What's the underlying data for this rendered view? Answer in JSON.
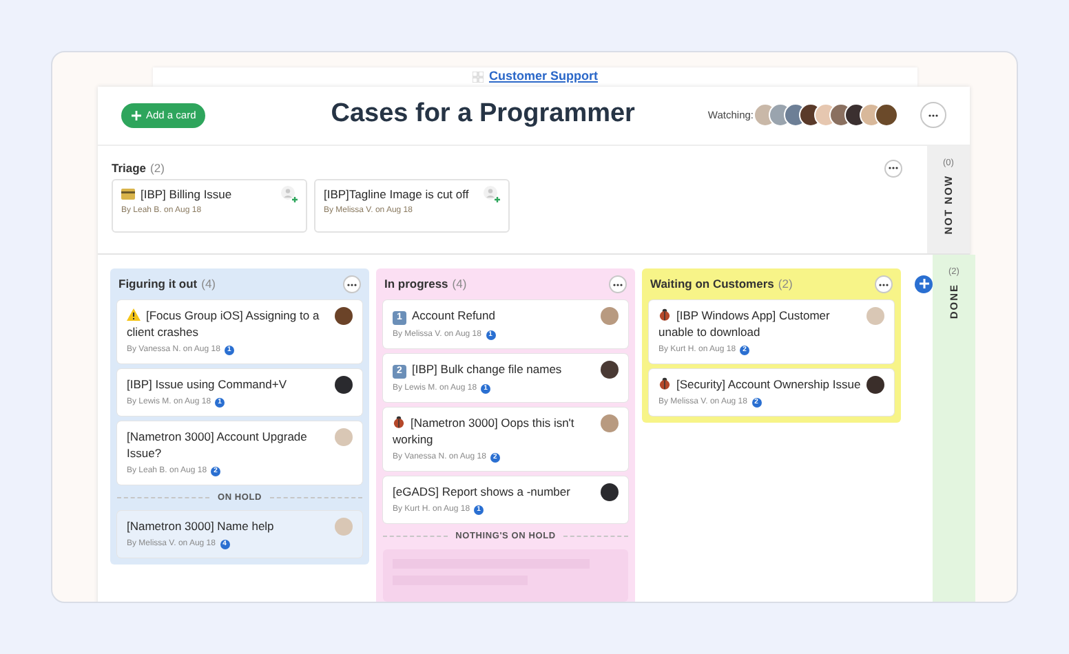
{
  "breadcrumb": {
    "label": "Customer Support"
  },
  "header": {
    "add_button": "Add a card",
    "title": "Cases for a Programmer",
    "watching_label": "Watching:",
    "watchers": [
      {
        "color": "#c9b8a8"
      },
      {
        "color": "#9aa4ae"
      },
      {
        "color": "#6d7f96"
      },
      {
        "color": "#5a3a2a"
      },
      {
        "color": "#e6c7b0"
      },
      {
        "color": "#8a7060"
      },
      {
        "color": "#3b3030"
      },
      {
        "color": "#d8b89a"
      },
      {
        "color": "#6b4a2a"
      }
    ]
  },
  "triage": {
    "title": "Triage",
    "count": "(2)",
    "cards": [
      {
        "icon": {
          "kind": "card"
        },
        "title": "[IBP] Billing Issue",
        "meta": "By Leah B. on Aug 18"
      },
      {
        "title": "[IBP]Tagline Image is cut off",
        "meta": "By Melissa V. on Aug 18"
      }
    ]
  },
  "side_columns": [
    {
      "kind": "not_now",
      "count": "(0)",
      "label": "NOT NOW"
    },
    {
      "kind": "done",
      "count": "(2)",
      "label": "DONE"
    }
  ],
  "columns": [
    {
      "kind": "blue",
      "title": "Figuring it out",
      "count": "(4)",
      "cards": [
        {
          "icon": {
            "kind": "warning"
          },
          "title": "[Focus Group iOS] Assigning to a client crashes",
          "meta": "By Vanessa N. on Aug 18",
          "badge": "1",
          "avatar": {
            "color": "#6b4328"
          }
        },
        {
          "title": "[IBP] Issue using Command+V",
          "meta": "By Lewis M. on Aug 18",
          "badge": "1",
          "avatar": {
            "color": "#2a2a2e"
          }
        },
        {
          "title": "[Nametron 3000] Account Upgrade Issue?",
          "meta": "By Leah B. on Aug 18",
          "badge": "2",
          "avatar": {
            "color": "#d9c7b5"
          }
        }
      ],
      "hold_label": "ON HOLD",
      "hold_cards": [
        {
          "title": "[Nametron 3000] Name help",
          "meta": "By Melissa V. on Aug 18",
          "badge": "4",
          "avatar": {
            "color": "#d9c7b5"
          }
        }
      ]
    },
    {
      "kind": "pink",
      "title": "In progress",
      "count": "(4)",
      "cards": [
        {
          "icon": {
            "kind": "keycap",
            "text": "1"
          },
          "title": "Account Refund",
          "meta": "By Melissa V. on Aug 18",
          "badge": "1",
          "avatar": {
            "color": "#b89a80"
          }
        },
        {
          "icon": {
            "kind": "keycap",
            "text": "2"
          },
          "title": "[IBP] Bulk change file names",
          "meta": "By Lewis M. on Aug 18",
          "badge": "1",
          "avatar": {
            "color": "#4a3a34"
          }
        },
        {
          "icon": {
            "kind": "bug"
          },
          "title": "[Nametron 3000] Oops this isn't working",
          "meta": "By Vanessa N. on Aug 18",
          "badge": "2",
          "avatar": {
            "color": "#b89a80"
          }
        },
        {
          "title": "[eGADS] Report shows a -number",
          "meta": "By Kurt H. on Aug 18",
          "badge": "1",
          "avatar": {
            "color": "#2a2a2e"
          }
        }
      ],
      "hold_label": "NOTHING'S ON HOLD"
    },
    {
      "kind": "yellow",
      "title": "Waiting on Customers",
      "count": "(2)",
      "cards": [
        {
          "icon": {
            "kind": "bug"
          },
          "title": "[IBP Windows App] Customer unable to download",
          "meta": "By Kurt H. on Aug 18",
          "badge": "2",
          "avatar": {
            "color": "#d9c7b5"
          }
        },
        {
          "icon": {
            "kind": "bug"
          },
          "title": "[Security] Account Ownership Issue",
          "meta": "By Melissa V. on Aug 18",
          "badge": "2",
          "avatar": {
            "color": "#3a2e2a"
          }
        }
      ]
    }
  ]
}
